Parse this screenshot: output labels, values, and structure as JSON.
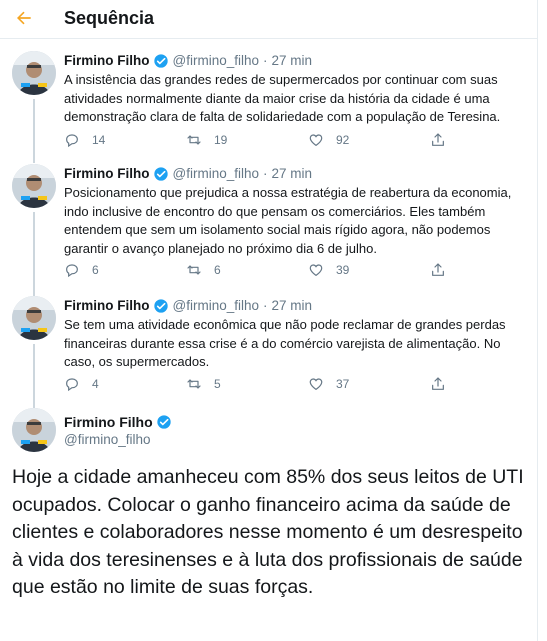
{
  "header": {
    "title": "Sequência"
  },
  "thread": [
    {
      "name": "Firmino Filho",
      "handle": "@firmino_filho",
      "time": "27 min",
      "text": "A insistência das grandes redes de supermercados por continuar com suas atividades normalmente diante da maior crise da história da cidade é uma demonstração clara de falta de solidariedade com a população de Teresina.",
      "replies": "14",
      "retweets": "19",
      "likes": "92"
    },
    {
      "name": "Firmino Filho",
      "handle": "@firmino_filho",
      "time": "27 min",
      "text": "Posicionamento que prejudica a nossa estratégia de reabertura da economia, indo inclusive de encontro do que pensam os comerciários. Eles também entendem que sem um isolamento social mais rígido agora, não podemos garantir o avanço planejado no próximo dia 6 de julho.",
      "replies": "6",
      "retweets": "6",
      "likes": "39"
    },
    {
      "name": "Firmino Filho",
      "handle": "@firmino_filho",
      "time": "27 min",
      "text": "Se tem uma atividade econômica que não pode reclamar de grandes perdas financeiras durante essa crise é a do comércio varejista de alimentação. No caso, os supermercados.",
      "replies": "4",
      "retweets": "5",
      "likes": "37"
    }
  ],
  "focus": {
    "name": "Firmino Filho",
    "handle": "@firmino_filho",
    "text": "Hoje a cidade amanheceu com 85% dos seus leitos de UTI ocupados. Colocar o ganho financeiro acima da saúde de clientes e colaboradores nesse momento é um desrespeito à vida dos teresinenses e à luta dos profissionais de saúde que estão no limite de suas forças."
  },
  "colors": {
    "accent": "#1da1f2",
    "back_arrow": "#f5a623",
    "secondary_text": "#657786",
    "thread_line": "#ccd6dd"
  },
  "icons": [
    "back-arrow-icon",
    "verified-badge-icon",
    "reply-icon",
    "retweet-icon",
    "like-icon",
    "share-icon"
  ]
}
